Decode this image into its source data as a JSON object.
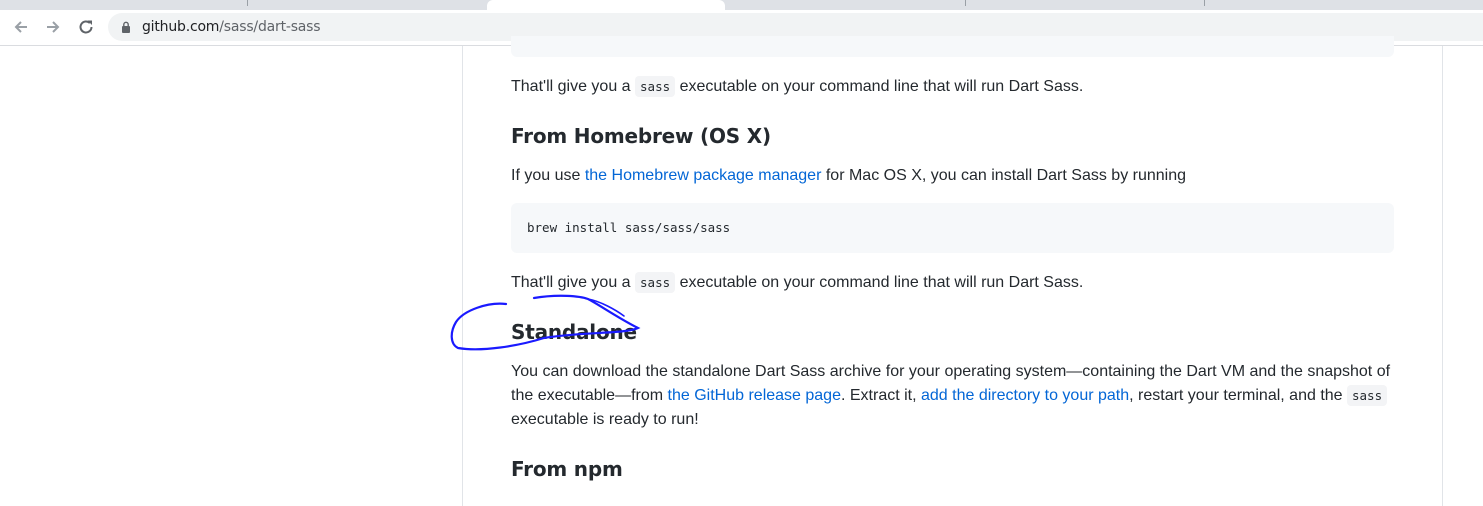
{
  "browser": {
    "url_host": "github.com",
    "url_path": "/sass/dart-sass",
    "back_icon": "arrow-left-icon",
    "forward_icon": "arrow-right-icon",
    "reload_icon": "reload-icon",
    "lock_icon": "lock-icon"
  },
  "readme": {
    "p1": {
      "before": "That'll give you a ",
      "code": "sass",
      "after": " executable on your command line that will run Dart Sass."
    },
    "homebrew_heading": "From Homebrew (OS X)",
    "p2": {
      "before": "If you use ",
      "link": "the Homebrew package manager",
      "after": " for Mac OS X, you can install Dart Sass by running"
    },
    "brew_code": "brew install sass/sass/sass",
    "p3": {
      "before": "That'll give you a ",
      "code": "sass",
      "after": " executable on your command line that will run Dart Sass."
    },
    "standalone_heading": "Standalone",
    "p4": {
      "text1": "You can download the standalone Dart Sass archive for your operating system—containing the Dart VM and the snapshot of the executable—from ",
      "link1": "the GitHub release page",
      "text2": ". Extract it, ",
      "link2": "add the directory to your path",
      "text3": ", restart your terminal, and the ",
      "code": "sass",
      "text4": " executable is ready to run!"
    },
    "npm_heading": "From npm"
  },
  "annotation_color": "#1a1aff"
}
